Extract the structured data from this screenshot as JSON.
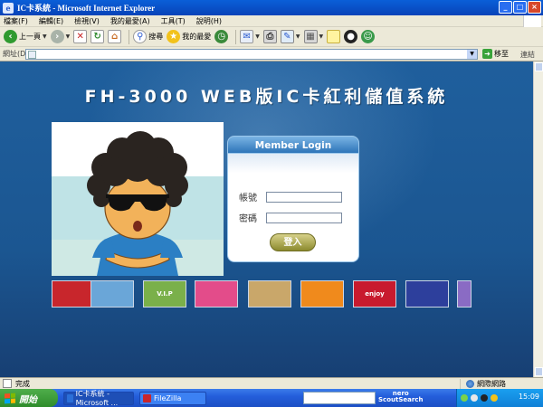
{
  "window": {
    "title": "IC卡系統 - Microsoft Internet Explorer",
    "icon_letter": "e"
  },
  "menu": [
    "檔案(F)",
    "編輯(E)",
    "檢視(V)",
    "我的最愛(A)",
    "工具(T)",
    "說明(H)"
  ],
  "toolbar": {
    "back_label": "上一頁",
    "search_label": "搜尋",
    "favorites_label": "我的最愛"
  },
  "address_bar": {
    "label": "網址(D)",
    "value": "",
    "go_label": "移至",
    "links_label": "連結"
  },
  "page": {
    "headline": "FH-3000 WEB版IC卡紅利儲值系統",
    "login": {
      "header": "Member Login",
      "account_label": "帳號",
      "password_label": "密碼",
      "account_value": "",
      "password_value": "",
      "submit_label": "登入"
    },
    "cards": [
      {
        "text": "",
        "color": "#c8262c"
      },
      {
        "text": "",
        "color": "#6aa6d8"
      },
      {
        "text": "V.I.P",
        "color": "#7ab04a"
      },
      {
        "text": "",
        "color": "#e34c8a"
      },
      {
        "text": "",
        "color": "#c9a76a"
      },
      {
        "text": "",
        "color": "#f08a1c"
      },
      {
        "text": "enjoy",
        "color": "#c81a2e"
      },
      {
        "text": "",
        "color": "#2d3f9c"
      },
      {
        "text": "",
        "color": "#8a6bc4"
      }
    ]
  },
  "status_bar": {
    "text": "完成",
    "zone": "網際網路"
  },
  "taskbar": {
    "start_label": "開始",
    "tasks": [
      {
        "label": "IC卡系統 - Microsoft ...",
        "icon_color": "#2b6fd8"
      },
      {
        "label": "FileZilla",
        "icon_color": "#c8262c"
      }
    ],
    "nero_text": "nero\nScoutSearch",
    "clock": "15:09"
  },
  "colors": {
    "page_background": "#1f5f9d",
    "login_header": "#2d74b8",
    "login_button": "#a8a440"
  }
}
